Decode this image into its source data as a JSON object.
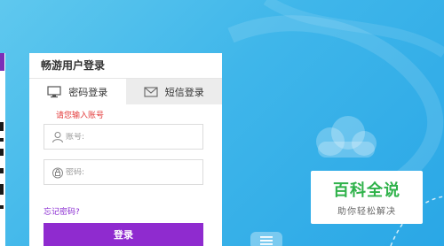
{
  "login_panel": {
    "title": "畅游用户登录",
    "tabs": [
      {
        "label": "密码登录",
        "icon": "monitor-icon",
        "active": true
      },
      {
        "label": "短信登录",
        "icon": "envelope-icon",
        "active": false
      }
    ],
    "error_message": "请您输入账号",
    "account_placeholder": "账号:",
    "password_placeholder": "密码:",
    "forgot_password": "忘记密码?",
    "login_button": "登录"
  },
  "watermark": {
    "title": "百科全说",
    "subtitle": "助你轻松解决"
  },
  "colors": {
    "background": "#3fb6ea",
    "accent_purple": "#8f2bcf",
    "error_red": "#e33b3b",
    "watermark_green": "#2fb24a"
  }
}
